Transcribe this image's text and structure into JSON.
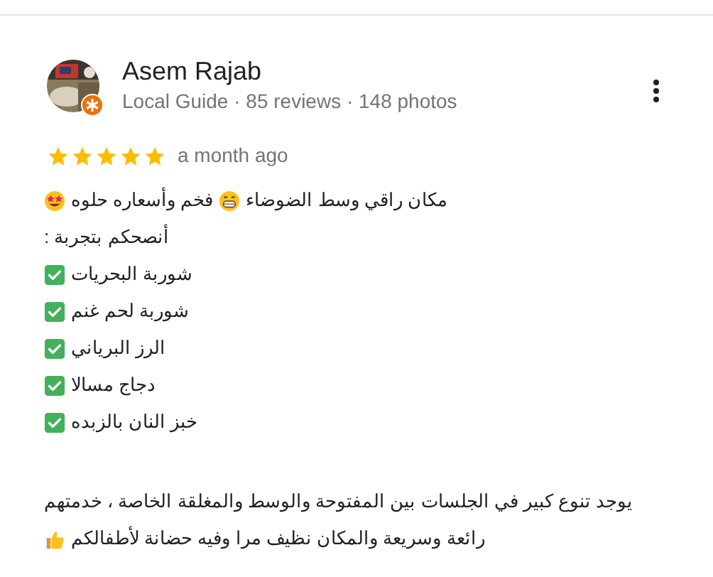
{
  "reviewer": {
    "name": "Asem Rajab",
    "details": "Local Guide · 85 reviews · 148 photos",
    "local_guide": true
  },
  "review": {
    "stars": 5,
    "time": "a month ago",
    "paragraphs": [
      {
        "lines": [
          {
            "segments": [
              {
                "kind": "text",
                "text": "مكان راقي وسط الضوضاء"
              },
              {
                "kind": "grin"
              },
              {
                "kind": "text",
                "text": "فخم وأسعاره حلوه"
              },
              {
                "kind": "star-eyes"
              }
            ]
          },
          {
            "segments": [
              {
                "kind": "text",
                "text": "أنصحكم بتجربة :"
              }
            ]
          },
          {
            "segments": [
              {
                "kind": "text",
                "text": "شوربة البحريات"
              },
              {
                "kind": "check"
              }
            ]
          },
          {
            "segments": [
              {
                "kind": "text",
                "text": "شوربة لحم غنم"
              },
              {
                "kind": "check"
              }
            ]
          },
          {
            "segments": [
              {
                "kind": "text",
                "text": "الرز البرياني"
              },
              {
                "kind": "check"
              }
            ]
          },
          {
            "segments": [
              {
                "kind": "text",
                "text": "دجاج مسالا"
              },
              {
                "kind": "check"
              }
            ]
          },
          {
            "segments": [
              {
                "kind": "text",
                "text": "خبز النان بالزبده"
              },
              {
                "kind": "check"
              }
            ]
          }
        ]
      },
      {
        "lines": [
          {
            "segments": [
              {
                "kind": "text",
                "text": "يوجد تنوع كبير في الجلسات بين المفتوحة والوسط والمغلقة الخاصة ، خدمتهم"
              }
            ]
          },
          {
            "segments": [
              {
                "kind": "text",
                "text": "رائعة وسريعة والمكان نظيف مرا وفيه حضانة لأطفالكم"
              },
              {
                "kind": "thumbs-up"
              }
            ]
          }
        ]
      }
    ]
  }
}
